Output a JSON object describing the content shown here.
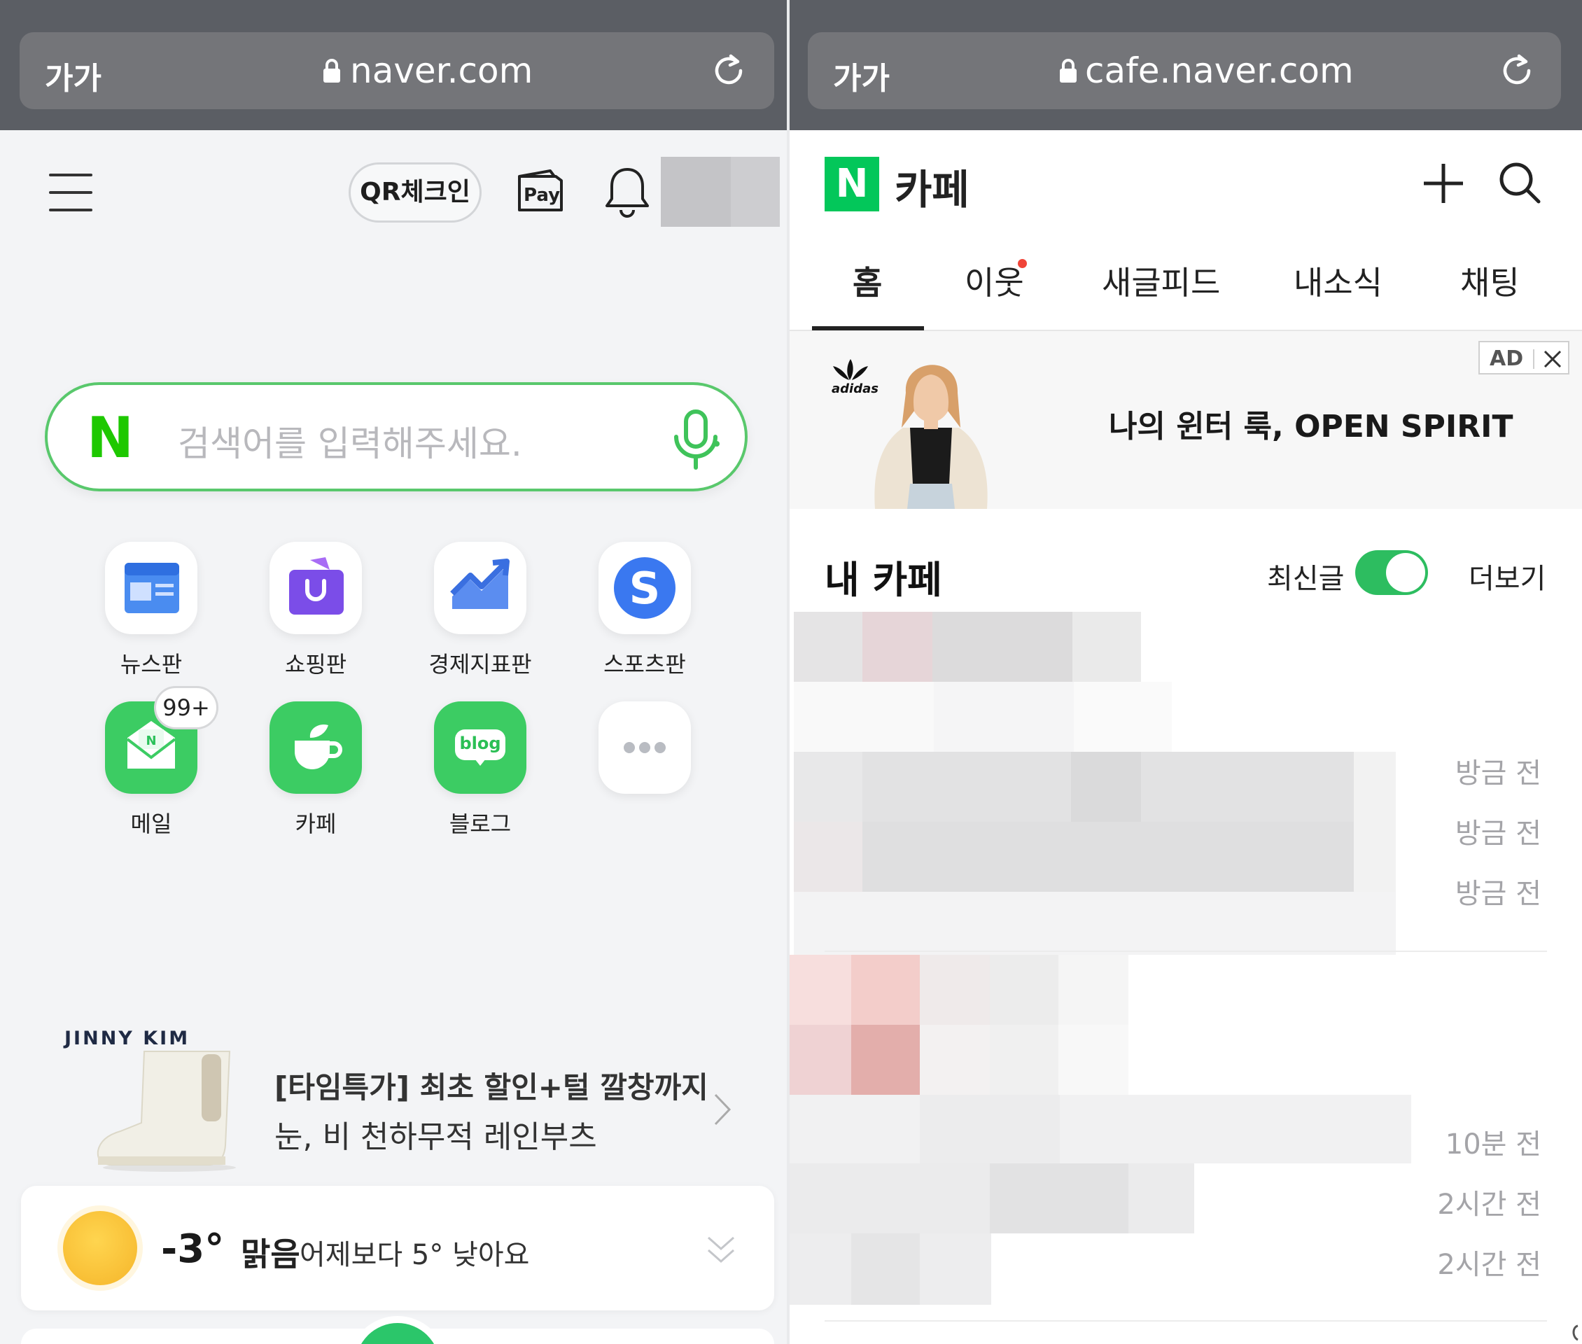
{
  "left_browser": {
    "aa_label": "가가",
    "url": "naver.com"
  },
  "naver_home": {
    "qr_label": "QR체크인",
    "pay_label": "Pay",
    "search_logo": "N",
    "search_placeholder": "검색어를 입력해주세요.",
    "apps": [
      {
        "label": "뉴스판",
        "icon": "news-icon"
      },
      {
        "label": "쇼핑판",
        "icon": "shopping-bag-icon"
      },
      {
        "label": "경제지표판",
        "icon": "chart-trend-icon"
      },
      {
        "label": "스포츠판",
        "icon": "sports-s-icon"
      },
      {
        "label": "메일",
        "icon": "mail-icon"
      },
      {
        "label": "카페",
        "icon": "cafe-cup-icon"
      },
      {
        "label": "블로그",
        "icon": "blog-icon"
      },
      {
        "label": "",
        "icon": "more-dots-icon"
      }
    ],
    "mail_badge": "99+",
    "blog_icon_text": "blog",
    "promo": {
      "brand": "JINNY KIM",
      "line1": "[타임특가] 최초 할인+털 깔창까지",
      "line2": "눈, 비 천하무적 레인부츠"
    },
    "weather": {
      "temp": "-3°",
      "condition": "맑음",
      "compare": "어제보다 5° 낮아요"
    }
  },
  "right_browser": {
    "aa_label": "가가",
    "url": "cafe.naver.com"
  },
  "cafe": {
    "logo": "N",
    "title": "카페",
    "tabs": [
      "홈",
      "이웃",
      "새글피드",
      "내소식",
      "채팅"
    ],
    "ad": {
      "brand": "adidas",
      "headline": "나의 윈터 룩, OPEN SPIRIT",
      "tag": "AD"
    },
    "my_cafe": {
      "title": "내 카페",
      "latest_label": "최신글",
      "latest_on": true,
      "more_label": "더보기",
      "times_group1": [
        "방금 전",
        "방금 전",
        "방금 전"
      ],
      "times_group2": [
        "10분 전",
        "2시간 전",
        "2시간 전"
      ]
    }
  },
  "colors": {
    "naver_green": "#03c75a",
    "search_border": "#59c86c",
    "toggle_on": "#2dbd60"
  }
}
